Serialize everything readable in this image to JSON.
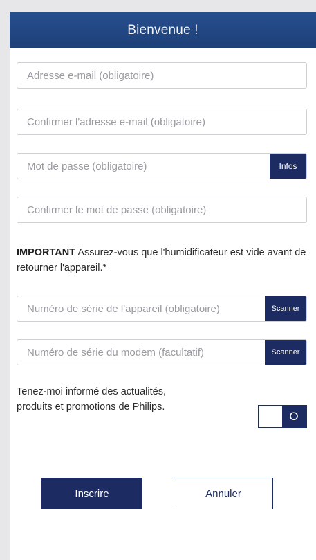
{
  "header": {
    "title": "Bienvenue !"
  },
  "form": {
    "email": {
      "placeholder": "Adresse e-mail (obligatoire)",
      "value": ""
    },
    "email_confirm": {
      "placeholder": "Confirmer l'adresse e-mail (obligatoire)",
      "value": ""
    },
    "password": {
      "placeholder": "Mot de passe (obligatoire)",
      "value": "",
      "info_label": "Infos"
    },
    "password_confirm": {
      "placeholder": "Confirmer le mot de passe (obligatoire)",
      "value": ""
    },
    "important": {
      "label": "IMPORTANT",
      "text": " Assurez-vous que l'humidificateur est vide avant de retourner l'appareil.*"
    },
    "device_serial": {
      "placeholder": "Numéro de série de l'appareil (obligatoire)",
      "value": "",
      "scan_label": "Scanner"
    },
    "modem_serial": {
      "placeholder": "Numéro de série du modem (facultatif)",
      "value": "",
      "scan_label": "Scanner"
    },
    "newsletter": {
      "text": "Tenez-moi informé des actualités, produits et promotions de Philips.",
      "toggle_label": "O",
      "enabled": false
    }
  },
  "actions": {
    "submit_label": "Inscrire",
    "cancel_label": "Annuler"
  },
  "colors": {
    "brand": "#1d2b63",
    "header": "#264f8e",
    "border": "#cfcfd4",
    "placeholder": "#9a9aa2"
  }
}
